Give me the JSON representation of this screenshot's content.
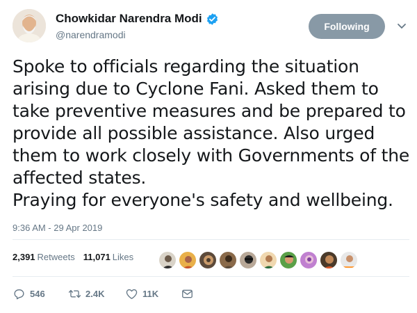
{
  "author": {
    "display_name": "Chowkidar Narendra Modi",
    "handle": "@narendramodi",
    "verified": true
  },
  "follow_button": {
    "label": "Following"
  },
  "tweet": {
    "text_lines": [
      "Spoke to officials regarding the situation arising due to Cyclone Fani. Asked them to take preventive measures and be prepared to provide all possible assistance. Also urged them to work closely with Governments of the affected states.",
      "Praying for everyone's safety and wellbeing."
    ],
    "timestamp": "9:36 AM - 29 Apr 2019"
  },
  "stats": {
    "retweets_count": "2,391",
    "retweets_label": "Retweets",
    "likes_count": "11,071",
    "likes_label": "Likes"
  },
  "actions": {
    "reply_count": "546",
    "retweet_count": "2.4K",
    "like_count": "11K"
  },
  "icons": {
    "verified": "verified-badge-icon",
    "caret": "chevron-down-icon",
    "reply": "reply-icon",
    "retweet": "retweet-icon",
    "like": "heart-icon",
    "dm": "envelope-icon"
  },
  "colors": {
    "primary_text": "#14171a",
    "secondary_text": "#657786",
    "verified_blue": "#1da1f2",
    "follow_button_bg": "#8899a6",
    "divider": "#e6ecf0"
  }
}
